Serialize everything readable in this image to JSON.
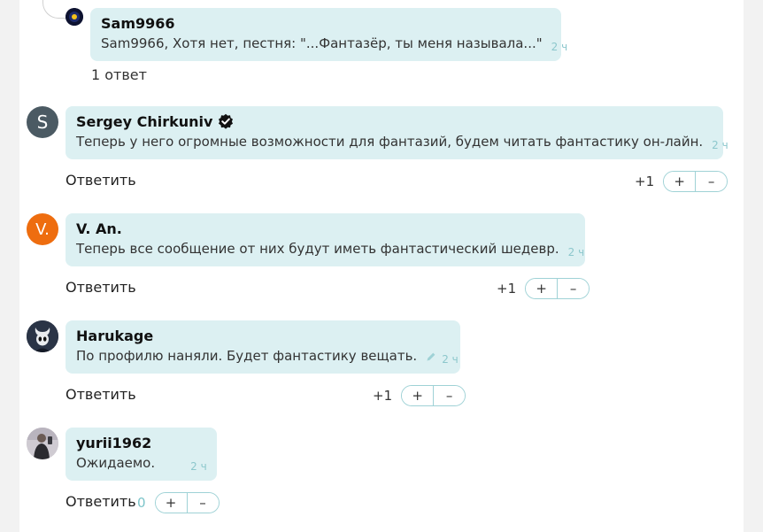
{
  "colors": {
    "bubble": "#dcf0f2",
    "accent": "#8cc7cc",
    "avatar_s": "#4b5a63",
    "avatar_v": "#ee6d0f"
  },
  "reply_label": "Ответить",
  "plus_label": "+",
  "minus_label": "–",
  "comments": [
    {
      "author": "Sam9966",
      "text": "Sam9966, Хотя нет, пестня: \"...Фантазёр, ты меня называла...\"",
      "time": "2 ч",
      "replies": "1 ответ"
    },
    {
      "author": "Sergey Chirkuniv",
      "avatar_letter": "S",
      "verified": true,
      "text": "Теперь у него огромные возможности для фантазий, будем читать фантастику он-лайн.",
      "time": "2 ч",
      "score": "+1"
    },
    {
      "author": "V. An.",
      "avatar_letter": "V.",
      "text": "Теперь все сообщение от них будут иметь фантастический шедевр.",
      "time": "2 ч",
      "score": "+1"
    },
    {
      "author": "Harukage",
      "text": "По профилю наняли. Будет фантастику вещать.",
      "time": "2 ч",
      "edited_icon": "pencil-icon",
      "score": "+1"
    },
    {
      "author": "yurii1962",
      "text": "Ожидаемо.",
      "time": "2 ч",
      "score": "0"
    }
  ]
}
